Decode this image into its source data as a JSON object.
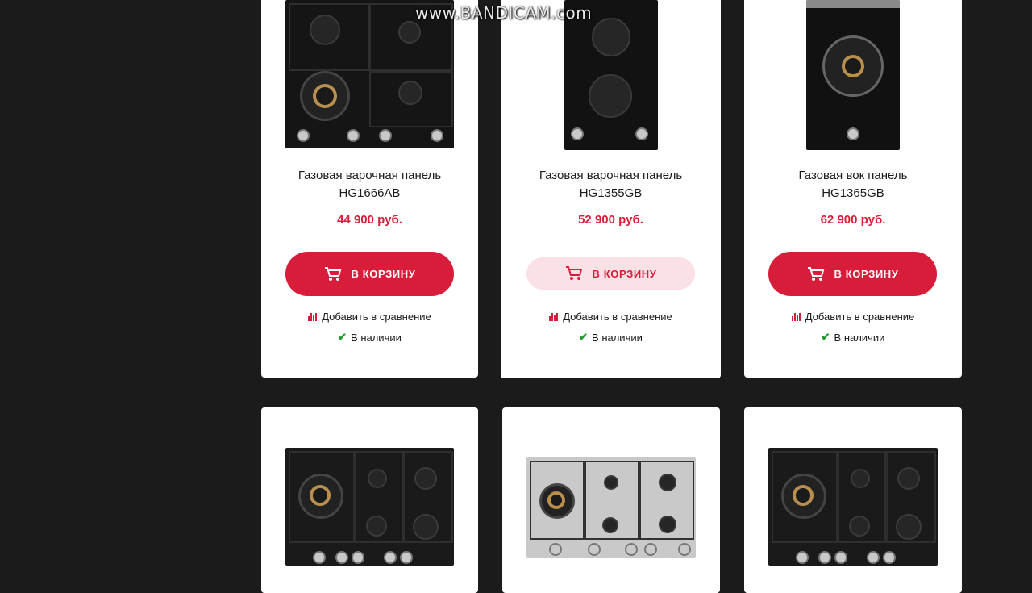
{
  "watermark": "www.BANDICAM.com",
  "products": [
    {
      "title_line1": "Газовая варочная панель",
      "title_line2": "HG1666AB",
      "price": "44 900 руб.",
      "cart_label": "В КОРЗИНУ",
      "compare_label": "Добавить в сравнение",
      "stock_label": "В наличии"
    },
    {
      "title_line1": "Газовая варочная панель",
      "title_line2": "HG1355GB",
      "price": "52 900 руб.",
      "cart_label": "В КОРЗИНУ",
      "compare_label": "Добавить в сравнение",
      "stock_label": "В наличии"
    },
    {
      "title_line1": "Газовая вок панель",
      "title_line2": "HG1365GB",
      "price": "62 900 руб.",
      "cart_label": "В КОРЗИНУ",
      "compare_label": "Добавить в сравнение",
      "stock_label": "В наличии"
    }
  ],
  "icons": {
    "cart": "cart-icon",
    "compare": "compare-bars-icon",
    "stock": "checkmark-icon"
  },
  "colors": {
    "accent": "#d81d3b",
    "price": "#d8203a",
    "in_stock": "#1e9a2c",
    "background": "#1c1b1b"
  }
}
